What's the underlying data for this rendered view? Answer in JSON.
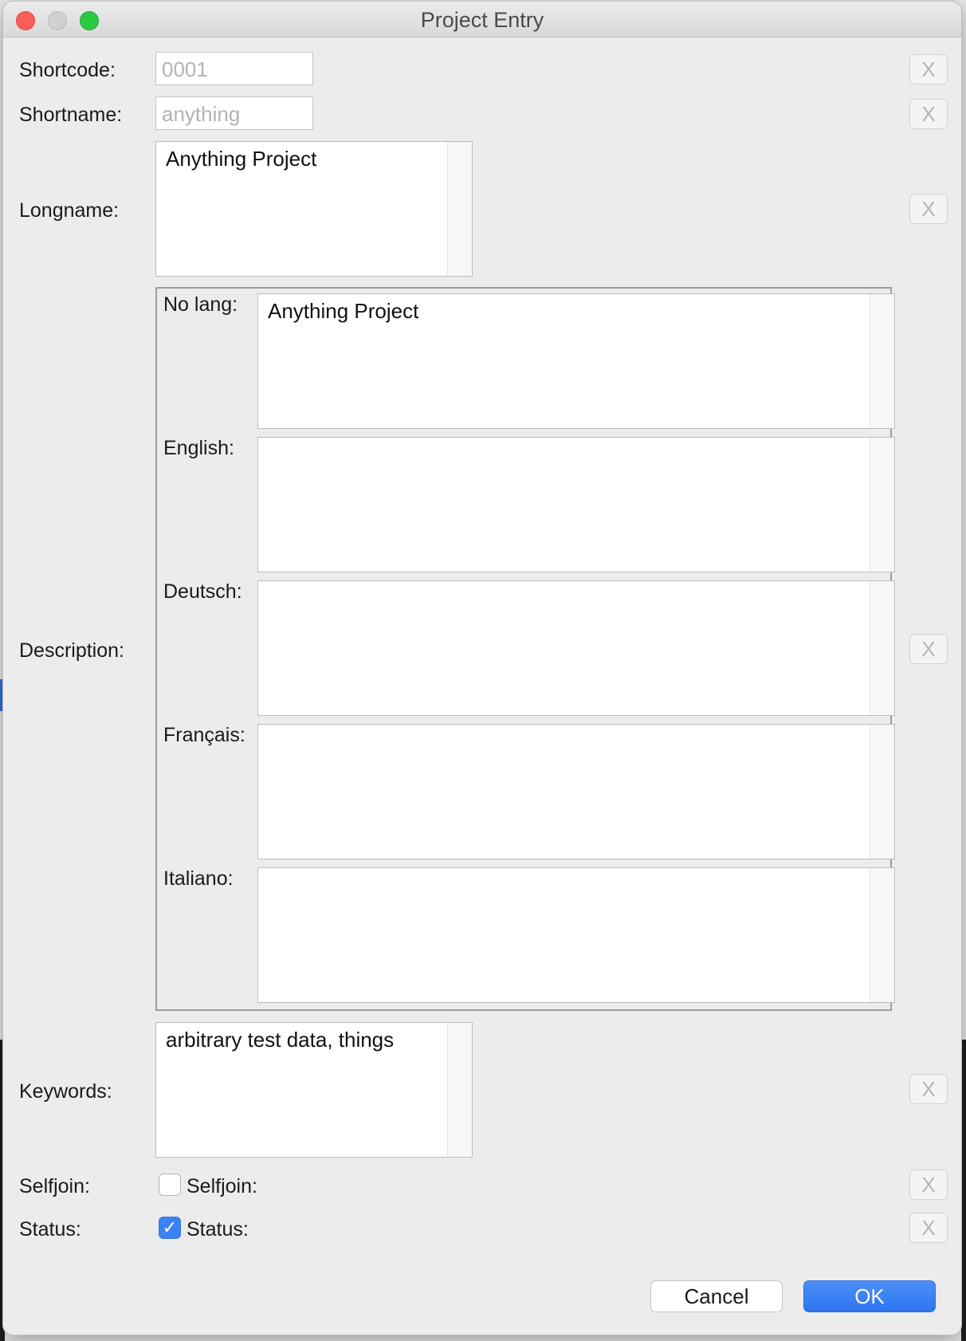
{
  "window": {
    "title": "Project Entry"
  },
  "fields": {
    "shortcode": {
      "label": "Shortcode:",
      "value": "0001"
    },
    "shortname": {
      "label": "Shortname:",
      "value": "anything"
    },
    "longname": {
      "label": "Longname:",
      "value": "Anything Project"
    },
    "description": {
      "label": "Description:",
      "languages": [
        {
          "label": "No lang:",
          "value": "Anything Project"
        },
        {
          "label": "English:",
          "value": ""
        },
        {
          "label": "Deutsch:",
          "value": ""
        },
        {
          "label": "Français:",
          "value": ""
        },
        {
          "label": "Italiano:",
          "value": ""
        }
      ]
    },
    "keywords": {
      "label": "Keywords:",
      "value": "arbitrary test data, things"
    },
    "selfjoin": {
      "label": "Selfjoin:",
      "checkbox_label": "Selfjoin:",
      "checked": false
    },
    "status": {
      "label": "Status:",
      "checkbox_label": "Status:",
      "checked": true
    }
  },
  "clear_button_label": "X",
  "checkmark": "✓",
  "buttons": {
    "cancel": "Cancel",
    "ok": "OK"
  }
}
